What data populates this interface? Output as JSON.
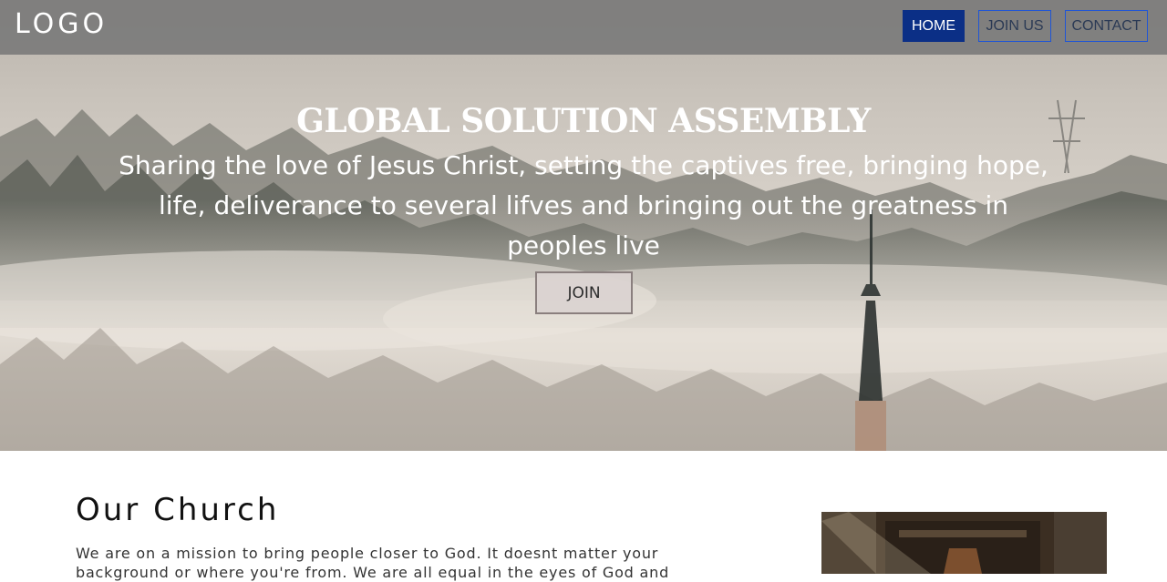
{
  "navbar": {
    "logo": "LOGO",
    "links": [
      {
        "label": "HOME",
        "active": true
      },
      {
        "label": "JOIN US",
        "active": false
      },
      {
        "label": "CONTACT",
        "active": false
      }
    ]
  },
  "hero": {
    "title": "GLOBAL SOLUTION ASSEMBLY",
    "subtitle_lines": [
      "Sharing the love of Jesus Christ, setting the captives free, bringing hope,",
      "life, deliverance to several lifves and bringing out the greatness in",
      "peoples live"
    ],
    "join_label": "JOIN"
  },
  "church": {
    "title": "Our Church",
    "text_lines": [
      "We are on a mission to bring people closer to God. It doesnt matter your",
      "background or where you're from. We are all equal in the eyes of God and"
    ]
  },
  "colors": {
    "nav_active_bg": "#0b2f86",
    "nav_border": "#1f55d6",
    "nav_bar_bg": "#787878"
  }
}
